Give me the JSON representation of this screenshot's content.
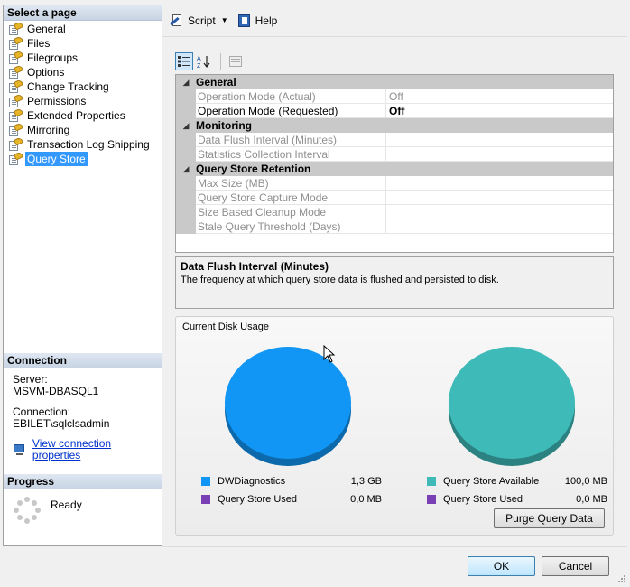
{
  "left": {
    "select_header": "Select a page",
    "pages": [
      {
        "label": "General",
        "icon": "page-wrench-icon"
      },
      {
        "label": "Files",
        "icon": "page-wrench-icon"
      },
      {
        "label": "Filegroups",
        "icon": "page-wrench-icon"
      },
      {
        "label": "Options",
        "icon": "page-wrench-icon"
      },
      {
        "label": "Change Tracking",
        "icon": "page-wrench-icon"
      },
      {
        "label": "Permissions",
        "icon": "page-wrench-icon"
      },
      {
        "label": "Extended Properties",
        "icon": "page-wrench-icon"
      },
      {
        "label": "Mirroring",
        "icon": "page-wrench-icon"
      },
      {
        "label": "Transaction Log Shipping",
        "icon": "page-wrench-icon"
      },
      {
        "label": "Query Store",
        "icon": "page-wrench-icon",
        "selected": true
      }
    ],
    "connection": {
      "header": "Connection",
      "server_label": "Server:",
      "server_value": "MSVM-DBASQL1",
      "connection_label": "Connection:",
      "connection_value": "EBILET\\sqlclsadmin",
      "link": "View connection properties"
    },
    "progress": {
      "header": "Progress",
      "status": "Ready"
    }
  },
  "toolbar": {
    "script_label": "Script",
    "help_label": "Help"
  },
  "grid": {
    "categories": [
      {
        "name": "General",
        "rows": [
          {
            "name": "Operation Mode (Actual)",
            "value": "Off",
            "disabled": true
          },
          {
            "name": "Operation Mode (Requested)",
            "value": "Off",
            "disabled": false,
            "bold": true
          }
        ]
      },
      {
        "name": "Monitoring",
        "rows": [
          {
            "name": "Data Flush Interval (Minutes)",
            "value": "",
            "disabled": true
          },
          {
            "name": "Statistics Collection Interval",
            "value": "",
            "disabled": true
          }
        ]
      },
      {
        "name": "Query Store Retention",
        "rows": [
          {
            "name": "Max Size (MB)",
            "value": "",
            "disabled": true
          },
          {
            "name": "Query Store Capture Mode",
            "value": "",
            "disabled": true
          },
          {
            "name": "Size Based Cleanup Mode",
            "value": "",
            "disabled": true
          },
          {
            "name": "Stale Query Threshold (Days)",
            "value": "",
            "disabled": true
          }
        ]
      }
    ]
  },
  "description": {
    "title": "Data Flush Interval (Minutes)",
    "text": "The frequency at which query store data is flushed and persisted to disk."
  },
  "disk": {
    "title": "Current Disk Usage",
    "left_legend": [
      {
        "label": "DWDiagnostics",
        "value": "1,3 GB",
        "color": "#1196f5"
      },
      {
        "label": "Query Store Used",
        "value": "0,0 MB",
        "color": "#7b3fb5"
      }
    ],
    "right_legend": [
      {
        "label": "Query Store Available",
        "value": "100,0 MB",
        "color": "#3ebab8"
      },
      {
        "label": "Query Store Used",
        "value": "0,0 MB",
        "color": "#7b3fb5"
      }
    ],
    "purge_label": "Purge Query Data"
  },
  "chart_data": [
    {
      "type": "pie",
      "categories": [
        "DWDiagnostics",
        "Query Store Used"
      ],
      "values": [
        1.3,
        0.0
      ],
      "colors": [
        "#1196f5",
        "#7b3fb5"
      ]
    },
    {
      "type": "pie",
      "categories": [
        "Query Store Available",
        "Query Store Used"
      ],
      "values": [
        100.0,
        0.0
      ],
      "colors": [
        "#3ebab8",
        "#7b3fb5"
      ]
    }
  ],
  "buttons": {
    "ok": "OK",
    "cancel": "Cancel"
  }
}
